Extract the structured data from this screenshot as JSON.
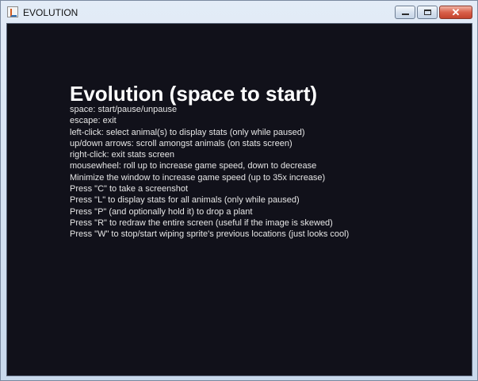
{
  "window": {
    "title": "EVOLUTION"
  },
  "icons": {
    "app": "java-app-icon",
    "minimize": "minimize-icon",
    "maximize": "maximize-icon",
    "close": "close-icon"
  },
  "colors": {
    "canvas_bg": "#11111a",
    "text": "#e6e6e6",
    "heading": "#ffffff",
    "close_button": "#c2432d"
  },
  "game": {
    "heading": "Evolution (space to start)",
    "instructions": [
      "space: start/pause/unpause",
      "escape: exit",
      "left-click: select animal(s) to display stats (only while paused)",
      "up/down arrows: scroll amongst animals (on stats screen)",
      "right-click: exit stats screen",
      "mousewheel: roll up to increase game speed, down to decrease",
      "Minimize the window to increase game speed (up to 35x increase)",
      "Press \"C\" to take a screenshot",
      "Press \"L\" to display stats for all animals (only while paused)",
      "Press \"P\" (and optionally hold it) to drop a plant",
      "Press \"R\" to redraw the entire screen (useful if the image is skewed)",
      "Press \"W\" to stop/start wiping sprite's previous locations (just looks cool)"
    ]
  }
}
